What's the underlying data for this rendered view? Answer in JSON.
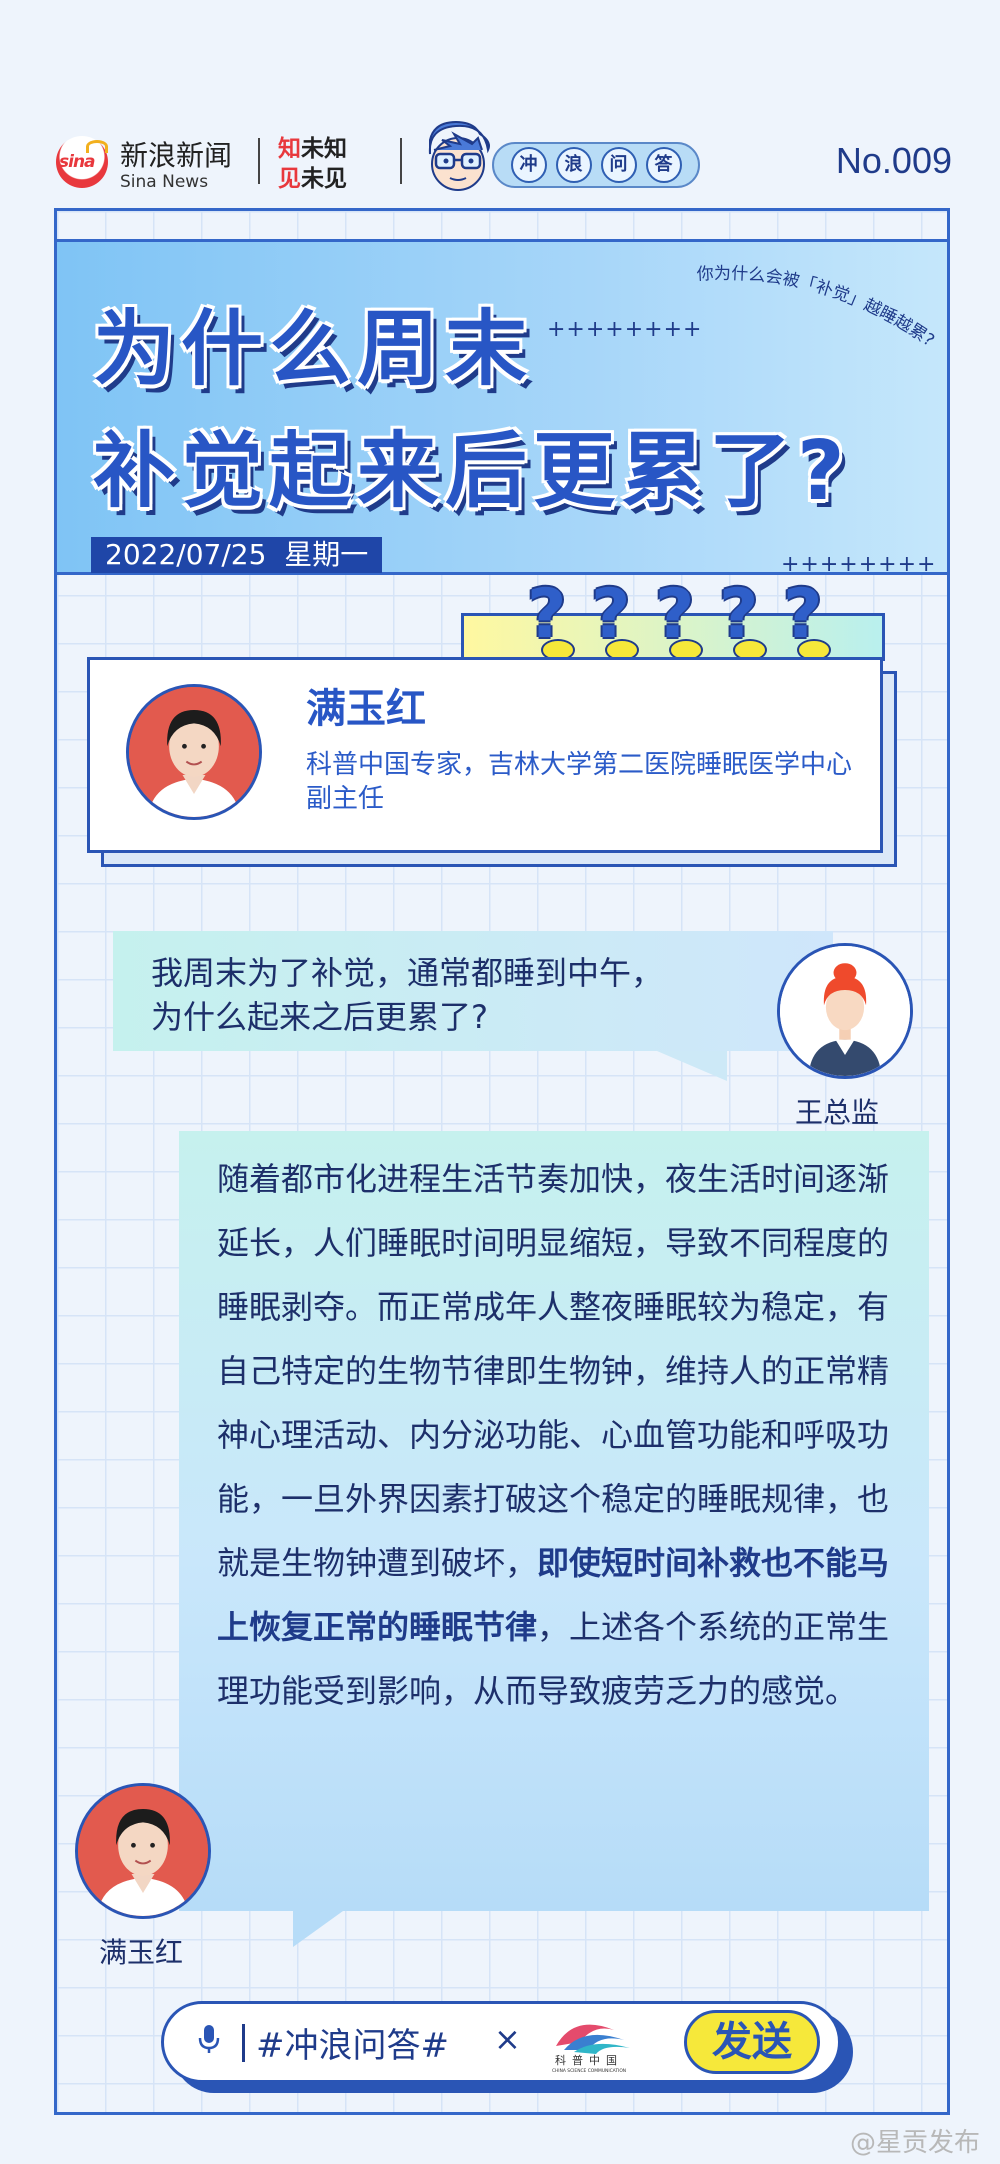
{
  "header": {
    "sina_logo_text": "sina",
    "sina_cn": "新浪新闻",
    "sina_en": "Sina News",
    "slogan_line1_red": "知",
    "slogan_line1_rest": "未知",
    "slogan_line2_red": "见",
    "slogan_line2_rest": "未见",
    "column_tag": [
      "冲",
      "浪",
      "问",
      "答"
    ],
    "issue_no": "No.009"
  },
  "hero": {
    "title_line1": "为什么周末",
    "title_line2": "补觉起来后更累了?",
    "arc_caption": "你为什么会被「补觉」越睡越累?",
    "stars": "++++++++",
    "date": "2022/07/25",
    "weekday": "星期一"
  },
  "expert": {
    "name": "满玉红",
    "title": "科普中国专家，吉林大学第二医院睡眠医学中心副主任",
    "question_marks": [
      "?",
      "?",
      "?",
      "?",
      "?"
    ]
  },
  "question": {
    "line1": "我周末为了补觉，通常都睡到中午，",
    "line2": "为什么起来之后更累了?",
    "asker_name": "王总监"
  },
  "answer": {
    "text_before": "随着都市化进程生活节奏加快，夜生活时间逐渐延长，人们睡眠时间明显缩短，导致不同程度的睡眠剥夺。而正常成年人整夜睡眠较为稳定，有自己特定的生物节律即生物钟，维持人的正常精神心理活动、内分泌功能、心血管功能和呼吸功能，一旦外界因素打破这个稳定的睡眠规律，也就是生物钟遭到破坏，",
    "text_bold": "即使短时间补救也不能马上恢复正常的睡眠节律",
    "text_after": "，上述各个系统的正常生理功能受到影响，从而导致疲劳乏力的感觉。",
    "answerer_name": "满玉红"
  },
  "input_bar": {
    "hashtag": "#冲浪问答#",
    "times": "×",
    "partner_logo_text": "科普中国",
    "partner_logo_sub": "CHINA SCIENCE COMMUNICATION",
    "send_label": "发送"
  },
  "watermark": "@星贡发布",
  "colors": {
    "primary_blue": "#2a55b5",
    "title_blue": "#2856c5",
    "accent_yellow": "#f6e83a",
    "sina_red": "#e8383d",
    "bubble_teal": "#c6f1ee"
  }
}
